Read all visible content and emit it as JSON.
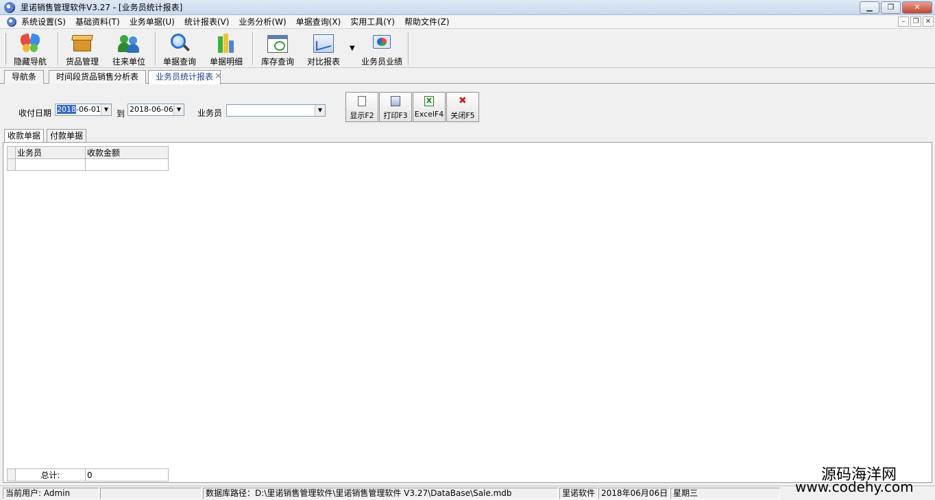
{
  "window": {
    "title": "里诺销售管理软件V3.27 - [业务员统计报表]",
    "btn_minimize": "▁",
    "btn_restore": "❐",
    "btn_close": "✕"
  },
  "menu": {
    "items": [
      "系统设置(S)",
      "基础资料(T)",
      "业务单据(U)",
      "统计报表(V)",
      "业务分析(W)",
      "单据查询(X)",
      "实用工具(Y)",
      "帮助文件(Z)"
    ],
    "mdi_min": "–",
    "mdi_restore": "❐",
    "mdi_close": "✕"
  },
  "toolbar": {
    "buttons": [
      {
        "label": "隐藏导航",
        "icon": "butterfly-icon"
      },
      {
        "label": "货品管理",
        "icon": "box-icon"
      },
      {
        "label": "往来单位",
        "icon": "people-icon"
      },
      {
        "label": "单据查询",
        "icon": "magnifier-icon"
      },
      {
        "label": "单据明细",
        "icon": "bar-chart-icon"
      },
      {
        "label": "库存查询",
        "icon": "stock-icon"
      },
      {
        "label": "对比报表",
        "icon": "compare-chart-icon"
      },
      {
        "label": "业务员业绩",
        "icon": "performance-icon"
      }
    ],
    "more_caret": "▼"
  },
  "doc_tabs": [
    "导航条",
    "时间段货品销售分析表",
    "业务员统计报表"
  ],
  "doc_tab_close": "✕",
  "filter": {
    "date_label": "收付日期",
    "date_from_year": "2018",
    "date_from_rest": "-06-01",
    "to_label": "到",
    "date_to": "2018-06-06",
    "salesman_label": "业务员",
    "salesman_value": "",
    "dropdown_arrow": "▼"
  },
  "actions": {
    "show": "显示F2",
    "print": "打印F3",
    "excel": "ExcelF4",
    "close": "关闭F5",
    "excel_glyph": "X",
    "close_glyph": "✖"
  },
  "inner_tabs": [
    "收款单据",
    "付款单据"
  ],
  "grid": {
    "columns": [
      "业务员",
      "收款金额"
    ],
    "total_label": "总计:",
    "total_value": "0"
  },
  "status": {
    "user": "当前用户: Admin",
    "blank": "",
    "db_path": "数据库路径：D:\\里诺销售管理软件\\里诺销售管理软件 V3.27\\DataBase\\Sale.mdb",
    "company": "里诺软件",
    "date": "2018年06月06日",
    "weekday": "星期三"
  },
  "watermark": {
    "line1": "源码海洋网",
    "line2": "www.codehy.com"
  }
}
